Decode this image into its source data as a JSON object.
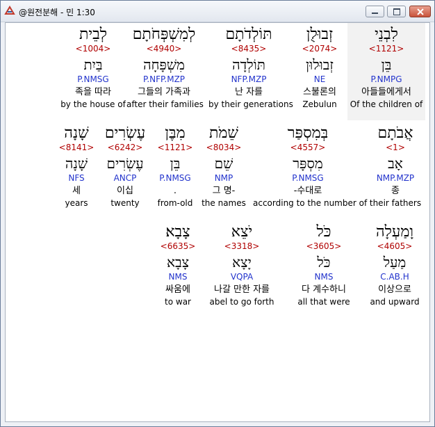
{
  "window": {
    "title": "@원전분해 - 민 1:30"
  },
  "icons": {
    "app": "app-logo-icon",
    "minimize": "minimize-icon",
    "maximize": "maximize-icon",
    "close": "close-icon"
  },
  "rows": [
    [
      {
        "heb": "לְבֵית",
        "strong": "<1004>",
        "lemma": "בַּיִת",
        "parse": "P.NMSG",
        "ko": "족을 따라",
        "en": "by the house of"
      },
      {
        "heb": "לְמִשְׁפְּחֹתָם",
        "strong": "<4940>",
        "lemma": "מִשְׁפָּחָה",
        "parse": "P.NFP.MZP",
        "ko": "그들의 가족과",
        "en": "after their families"
      },
      {
        "heb": "תּוֹלְדֹתָם",
        "strong": "<8435>",
        "lemma": "תּוֹלְדָה",
        "parse": "NFP.MZP",
        "ko": "난 자를",
        "en": "by their generations"
      },
      {
        "heb": "זְבוּלֻן",
        "strong": "<2074>",
        "lemma": "זְבוּלוּן",
        "parse": "NE",
        "ko": "스불론의",
        "en": "Zebulun"
      },
      {
        "heb": "לִבְנֵי",
        "strong": "<1121>",
        "lemma": "בֵּן",
        "parse": "P.NMPG",
        "ko": "아들들에게서",
        "en": "Of the children of",
        "selected": true
      }
    ],
    [
      {
        "heb": "שָׁנָה",
        "strong": "<8141>",
        "lemma": "שָׁנָה",
        "parse": "NFS",
        "ko": "세",
        "en": "years"
      },
      {
        "heb": "עֶשְׂרִים",
        "strong": "<6242>",
        "lemma": "עֶשְׂרִים",
        "parse": "ANCP",
        "ko": "이십",
        "en": "twenty"
      },
      {
        "heb": "מִבֶּן",
        "strong": "<1121>",
        "lemma": "בֵּן",
        "parse": "P.NMSG",
        "ko": ".",
        "en": "from-old"
      },
      {
        "heb": "שֵׁמֹת",
        "strong": "<8034>",
        "lemma": "שֵׁם",
        "parse": "NMP",
        "ko": "그 명-",
        "en": "the names"
      },
      {
        "heb": "בְּמִסְפַּר",
        "strong": "<4557>",
        "lemma": "מִסְפָּר",
        "parse": "P.NMSG",
        "ko": "-수대로",
        "en": "according to the number of"
      },
      {
        "heb": "אֲבֹתָם",
        "strong": "<1>",
        "lemma": "אָב",
        "parse": "NMP.MZP",
        "ko": "종",
        "en": "their fathers"
      }
    ],
    [
      {
        "heb": "צָבָא׃",
        "strong": "<6635>",
        "lemma": "צָבָא",
        "parse": "NMS",
        "ko": "싸움에",
        "en": "to war"
      },
      {
        "heb": "יֹצֵא",
        "strong": "<3318>",
        "lemma": "יָצָא",
        "parse": "VQPA",
        "ko": "나갈 만한 자를",
        "en": "abel to go forth"
      },
      {
        "heb": "כֹּל",
        "strong": "<3605>",
        "lemma": "כֹּל",
        "parse": "NMS",
        "ko": "다 계수하니",
        "en": "all that were"
      },
      {
        "heb": "וָמַעְלָה",
        "strong": "<4605>",
        "lemma": "מַעַל",
        "parse": "C.AB.H",
        "ko": "이상으로",
        "en": "and upward"
      }
    ]
  ]
}
